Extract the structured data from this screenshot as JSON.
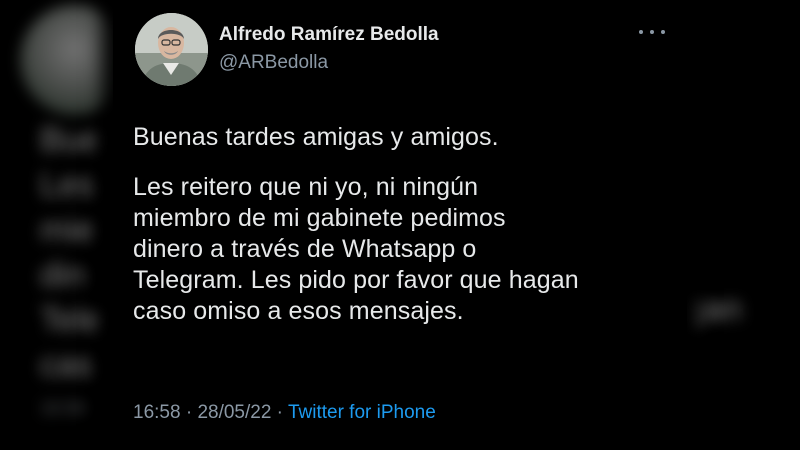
{
  "tweet": {
    "author_name": "Alfredo Ramírez Bedolla",
    "handle": "@ARBedolla",
    "paragraph1": "Buenas tardes amigas y amigos.",
    "paragraph2_lines": [
      "Les reitero que ni yo, ni ningún",
      "miembro de mi gabinete pedimos",
      "dinero a través de Whatsapp o",
      "Telegram. Les pido por favor que hagan",
      "caso omiso a esos mensajes."
    ],
    "time": "16:58",
    "separator": " · ",
    "date": "28/05/22",
    "source": "Twitter for iPhone",
    "more_icon": "more-horizontal-icon"
  },
  "background_fragments": {
    "lines": [
      "Bue",
      "Les",
      "mie",
      "din",
      "Tele",
      "cas"
    ],
    "right_fragment": "gan",
    "time_fragment": "16:58"
  },
  "colors": {
    "background": "#000000",
    "text": "#e7e9ea",
    "secondary": "#8b98a5",
    "link": "#1d9bf0"
  }
}
